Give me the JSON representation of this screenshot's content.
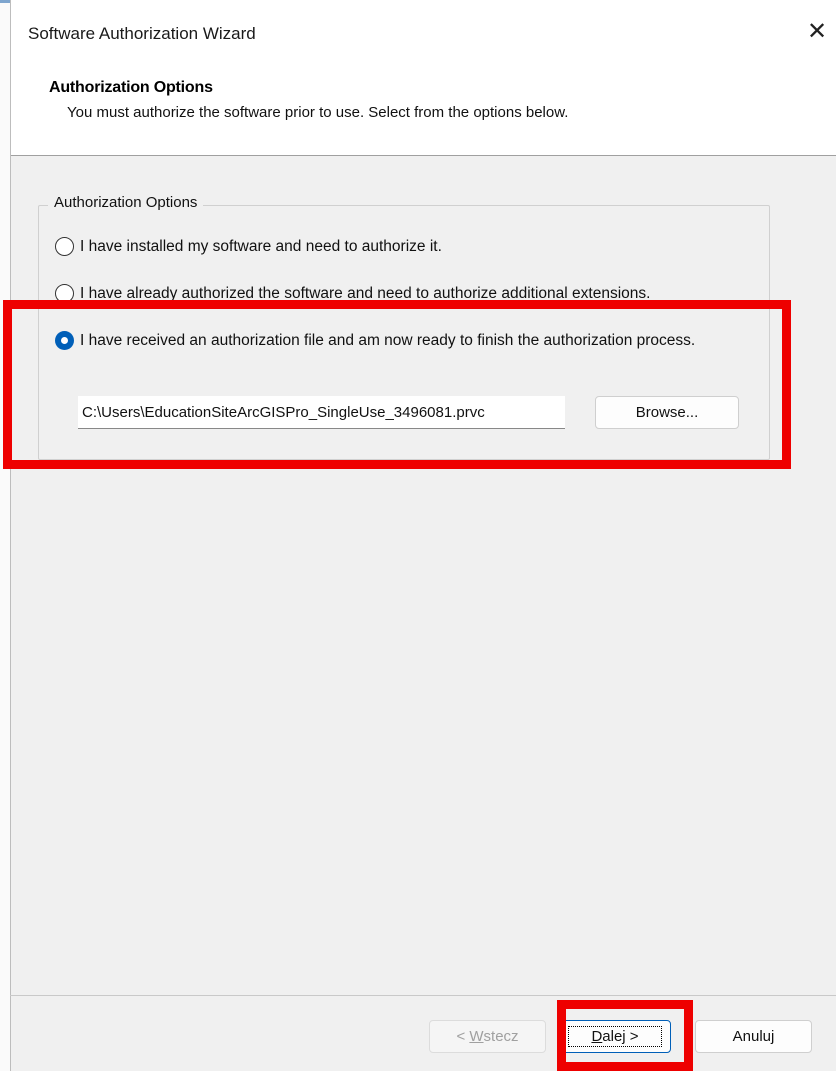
{
  "window": {
    "title": "Software Authorization Wizard",
    "close_glyph": "✕"
  },
  "header": {
    "title": "Authorization Options",
    "subtitle": "You must authorize the software prior to use. Select from the options below."
  },
  "group": {
    "label": "Authorization Options",
    "options": [
      {
        "label": "I have installed my software and need to authorize it.",
        "checked": false
      },
      {
        "label": "I have already authorized the software and need to authorize additional extensions.",
        "checked": false
      },
      {
        "label": "I have received an authorization file and am now ready to finish the authorization process.",
        "checked": true
      }
    ],
    "file_path": "C:\\Users\\EducationSiteArcGISPro_SingleUse_3496081.prvc",
    "browse_label": "Browse..."
  },
  "footer": {
    "back_prefix": "< ",
    "back_access": "W",
    "back_rest": "stecz",
    "next_access": "D",
    "next_rest": "alej >",
    "cancel_label": "Anuluj"
  },
  "colors": {
    "highlight": "#ee0000",
    "accent": "#005fb8"
  },
  "icons": [
    "close-icon",
    "radio-unchecked-icon",
    "radio-checked-icon"
  ]
}
